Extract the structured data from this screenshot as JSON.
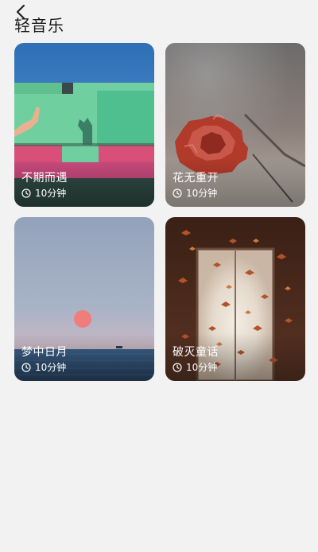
{
  "header": {
    "back_icon": "chevron-left-icon",
    "title": "轻音乐"
  },
  "cards": [
    {
      "id": "buqi",
      "title": "不期而遇",
      "duration": "10分钟",
      "icon": "clock-icon"
    },
    {
      "id": "huawu",
      "title": "花无重开",
      "duration": "10分钟",
      "icon": "clock-icon"
    },
    {
      "id": "mengzhong",
      "title": "梦中日月",
      "duration": "10分钟",
      "icon": "clock-icon"
    },
    {
      "id": "pomie",
      "title": "破灭童话",
      "duration": "10分钟",
      "icon": "clock-icon"
    }
  ],
  "colors": {
    "background": "#f2f2f2",
    "title_text": "#1a1a1a",
    "card_text": "#ffffff"
  }
}
